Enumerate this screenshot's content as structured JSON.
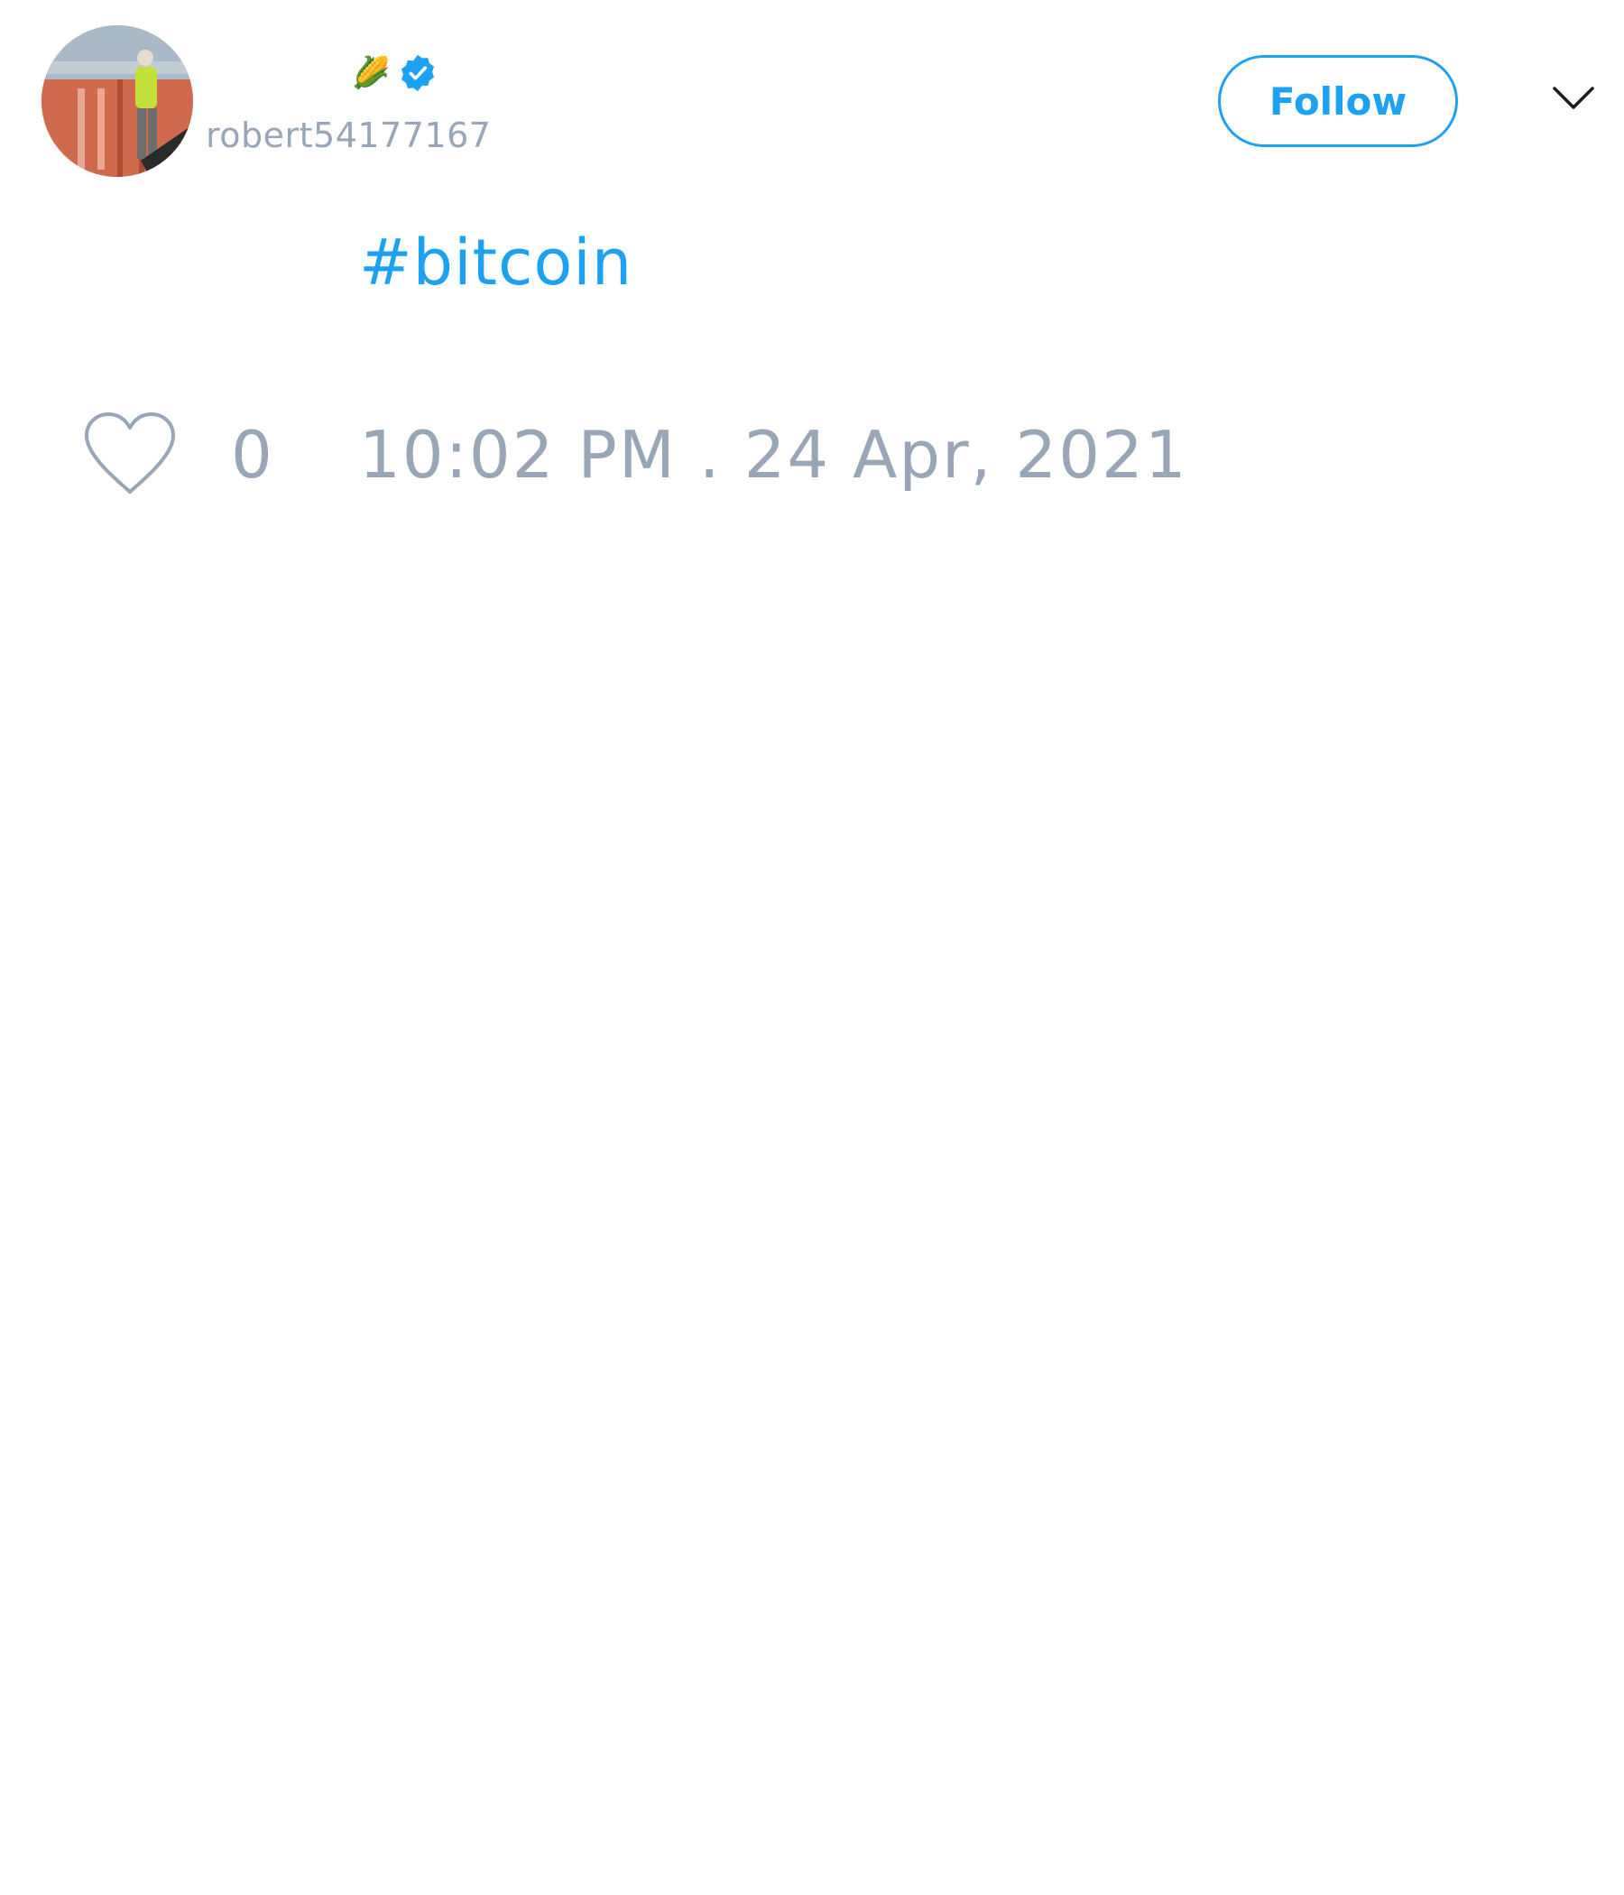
{
  "user": {
    "handle": "robert54177167",
    "name_emoji": "🌽",
    "verified": true
  },
  "header": {
    "follow_label": "Follow",
    "menu_icon": "chevron-down-icon"
  },
  "tweet": {
    "text": "#bitcoin",
    "like_count": "0",
    "timestamp": "10:02 PM . 24 Apr, 2021"
  },
  "colors": {
    "accent": "#1da1f2",
    "muted": "#98a6b8"
  }
}
